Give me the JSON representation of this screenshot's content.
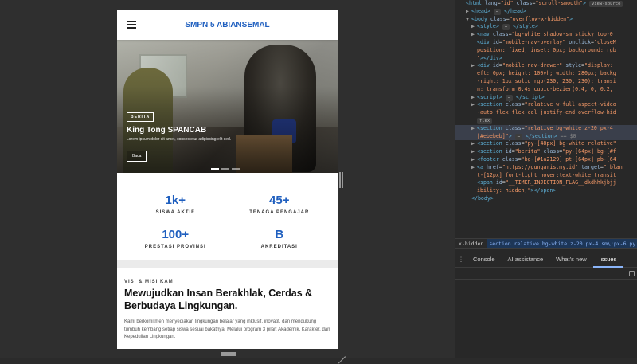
{
  "site": {
    "title": "SMPN 5 ABIANSEMAL",
    "hero": {
      "badge": "BERITA",
      "title": "King Tong SPANCAB",
      "description": "Lorem ipsum dolor sit amet, consectetur adipiscing elit sed.",
      "button": "Baca"
    },
    "stats": [
      {
        "value": "1k+",
        "label": "SISWA AKTIF"
      },
      {
        "value": "45+",
        "label": "TENAGA PENGAJAR"
      },
      {
        "value": "100+",
        "label": "PRESTASI PROVINSI"
      },
      {
        "value": "B",
        "label": "AKREDITASI"
      }
    ],
    "visi_misi": {
      "kicker": "VISI & MISI KAMI",
      "title": "Mewujudkan Insan Berakhlak, Cerdas & Berbudaya Lingkungan.",
      "body": "Kami berkomitmen menyediakan lingkungan belajar yang inklusif, inovatif, dan mendukung tumbuh kembang setiap siswa sesuai bakatnya. Melalui program 3 pilar: Akademik, Karakter, dan Kepedulian Lingkungan."
    }
  },
  "devtools": {
    "dom_lines": [
      {
        "indent": 0,
        "arrow": "",
        "html": "<span class=\"tag\">&lt;html</span> <span class=\"attr\">lang</span>=<span class=\"val\">\"id\"</span> <span class=\"attr\">class</span>=<span class=\"val\">\"scroll-smooth\"</span><span class=\"tag\">&gt;</span> <span class=\"pill\">view-source</span>"
      },
      {
        "indent": 1,
        "arrow": "▶",
        "html": "<span class=\"tag\">&lt;head&gt;</span> <span class=\"pill\">⋯</span> <span class=\"tag\">&lt;/head&gt;</span>"
      },
      {
        "indent": 1,
        "arrow": "▼",
        "html": "<span class=\"tag\">&lt;body</span> <span class=\"attr\">class</span>=<span class=\"val\">\"overflow-x-hidden\"</span><span class=\"tag\">&gt;</span>"
      },
      {
        "indent": 2,
        "arrow": "▶",
        "html": "<span class=\"tag\">&lt;style&gt;</span> <span class=\"pill\">⋯</span> <span class=\"tag\">&lt;/style&gt;</span>"
      },
      {
        "indent": 2,
        "arrow": "▶",
        "html": "<span class=\"tag\">&lt;nav</span> <span class=\"attr\">class</span>=<span class=\"val\">\"bg-white shadow-sm sticky top-0</span>"
      },
      {
        "indent": 2,
        "arrow": "",
        "html": "<span class=\"tag\">&lt;div</span> <span class=\"attr\">id</span>=<span class=\"val\">\"mobile-nav-overlay\"</span> <span class=\"attr\">onclick</span>=<span class=\"val\">\"closeM</span>"
      },
      {
        "indent": 2,
        "arrow": "",
        "html": "<span class=\"val\">position: fixed; inset: 0px; background: rgb</span>"
      },
      {
        "indent": 2,
        "arrow": "",
        "html": "<span class=\"val\">\"</span><span class=\"tag\">&gt;&lt;/div&gt;</span>"
      },
      {
        "indent": 2,
        "arrow": "▶",
        "html": "<span class=\"tag\">&lt;div</span> <span class=\"attr\">id</span>=<span class=\"val\">\"mobile-nav-drawer\"</span> <span class=\"attr\">style</span>=<span class=\"val\">\"display:</span>"
      },
      {
        "indent": 2,
        "arrow": "",
        "html": "<span class=\"val\">eft: 0px; height: 100vh; width: 280px; backg</span>"
      },
      {
        "indent": 2,
        "arrow": "",
        "html": "<span class=\"val\">-right: 1px solid rgb(230, 230, 230); transi</span>"
      },
      {
        "indent": 2,
        "arrow": "",
        "html": "<span class=\"val\">n: transform 0.4s cubic-bezier(0.4, 0, 0.2,</span>"
      },
      {
        "indent": 2,
        "arrow": "▶",
        "html": "<span class=\"tag\">&lt;script&gt;</span> <span class=\"pill\">⋯</span> <span class=\"tag\">&lt;/script&gt;</span>"
      },
      {
        "indent": 2,
        "arrow": "▶",
        "html": "<span class=\"tag\">&lt;section</span> <span class=\"attr\">class</span>=<span class=\"val\">\"relative w-full aspect-video</span>"
      },
      {
        "indent": 2,
        "arrow": "",
        "html": "<span class=\"val\">-auto flex flex-col justify-end overflow-hid</span>"
      },
      {
        "indent": 2,
        "arrow": "",
        "html": "<span class=\"pill\">flex</span>"
      },
      {
        "indent": 2,
        "arrow": "▶",
        "html": "<span class=\"tag\">&lt;section</span> <span class=\"attr\">class</span>=<span class=\"val\">\"relative bg-white z-20 px-4</span>",
        "selected": true
      },
      {
        "indent": 2,
        "arrow": "",
        "html": "<span class=\"val\">[#ebebeb]\"</span><span class=\"tag\">&gt;</span> <span class=\"pill\">⋯</span> <span class=\"tag\">&lt;/section&gt;</span> <span class=\"dollar\">== $0</span>",
        "selected": true
      },
      {
        "indent": 2,
        "arrow": "▶",
        "html": "<span class=\"tag\">&lt;section</span> <span class=\"attr\">class</span>=<span class=\"val\">\"py-[48px] bg-white relative\"</span>"
      },
      {
        "indent": 2,
        "arrow": "▶",
        "html": "<span class=\"tag\">&lt;section</span> <span class=\"attr\">id</span>=<span class=\"val\">\"berita\"</span> <span class=\"attr\">class</span>=<span class=\"val\">\"py-[64px] bg-[#f</span>"
      },
      {
        "indent": 2,
        "arrow": "▶",
        "html": "<span class=\"tag\">&lt;footer</span> <span class=\"attr\">class</span>=<span class=\"val\">\"bg-[#1a2129] pt-[64px] pb-[64</span>"
      },
      {
        "indent": 2,
        "arrow": "▶",
        "html": "<span class=\"tag\">&lt;a</span> <span class=\"attr\">href</span>=<span class=\"val\">\"https://gungaris.my.id\"</span> <span class=\"attr\">target</span>=<span class=\"val\">\"_blan</span>"
      },
      {
        "indent": 2,
        "arrow": "",
        "html": "<span class=\"val\">t-[12px] font-light hover:text-white transit</span>"
      },
      {
        "indent": 2,
        "arrow": "",
        "html": "<span class=\"tag\">&lt;span</span> <span class=\"attr\">id</span>=<span class=\"val\">\"__TIMER_INJECTION_FLAG__dkdhhkjbjj</span>"
      },
      {
        "indent": 2,
        "arrow": "",
        "html": "<span class=\"val\">ibility: hidden;\"</span><span class=\"tag\">&gt;&lt;/span&gt;</span>"
      },
      {
        "indent": 1,
        "arrow": "",
        "html": "<span class=\"tag\">&lt;/body&gt;</span>"
      }
    ],
    "breadcrumb_prev": "x-hidden",
    "breadcrumb_current": "section.relative.bg-white.z-20.px-4.sm\\:px-6.py",
    "tabs": [
      "Console",
      "AI assistance",
      "What's new",
      "Issues"
    ]
  },
  "colors": {
    "accent": "#1f5fbf",
    "devtools_bg": "#282828"
  }
}
